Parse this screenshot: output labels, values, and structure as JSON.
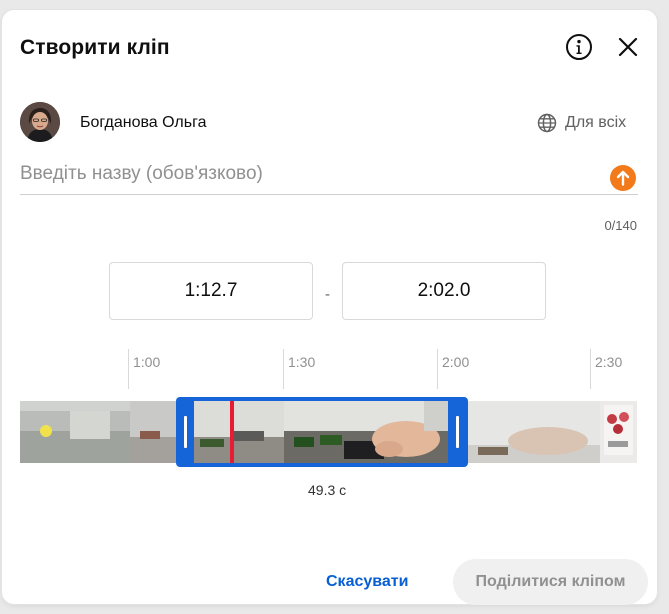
{
  "dialog": {
    "title": "Створити кліп"
  },
  "author": {
    "name": "Богданова Ольга"
  },
  "visibility": {
    "label": "Для всіх",
    "icon": "globe-icon"
  },
  "clip_title": {
    "placeholder": "Введіть назву (обов'язково)",
    "value": "",
    "counter": "0/140",
    "icon": "upload-arrow-icon"
  },
  "range": {
    "start": "1:12.7",
    "separator": "-",
    "end": "2:02.0"
  },
  "timeline": {
    "ticks": [
      "1:00",
      "1:30",
      "2:00",
      "2:30"
    ],
    "duration": "49.3 с"
  },
  "buttons": {
    "cancel": "Скасувати",
    "share": "Поділитися кліпом"
  },
  "colors": {
    "accent": "#065fd4",
    "selection": "#1565d8",
    "playhead": "#e81b35",
    "upload": "#f27a1a"
  }
}
